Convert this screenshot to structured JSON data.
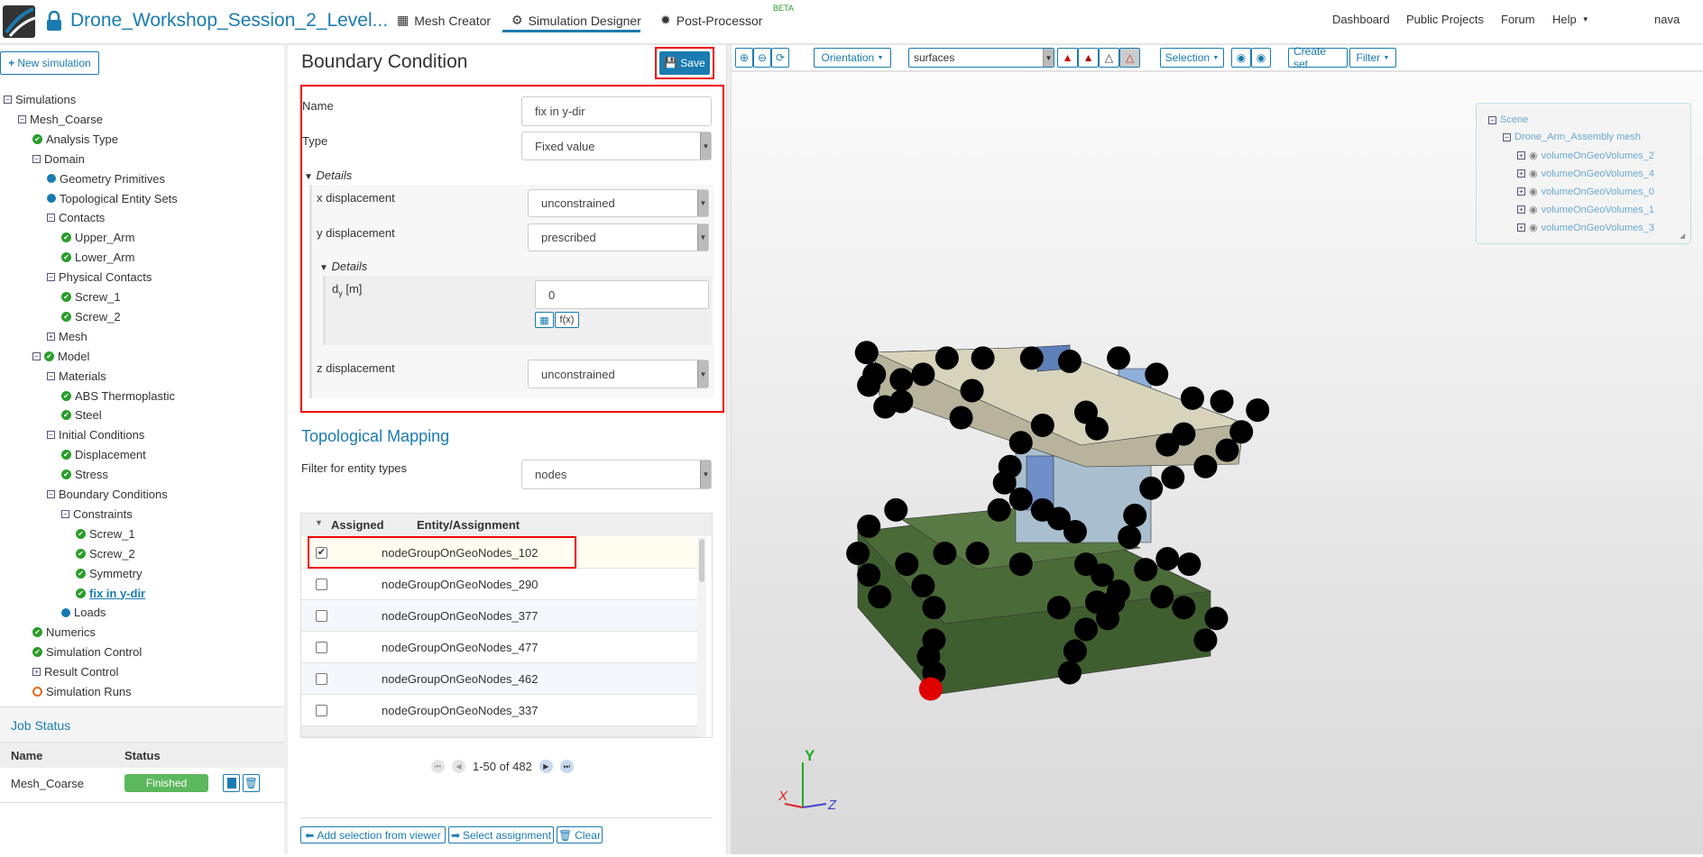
{
  "nav": {
    "project_title": "Drone_Workshop_Session_2_Level...",
    "tabs": [
      {
        "label": "Mesh Creator"
      },
      {
        "label": "Simulation Designer"
      },
      {
        "label": "Post-Processor"
      }
    ],
    "beta": "BETA",
    "right": [
      {
        "label": "Dashboard"
      },
      {
        "label": "Public Projects"
      },
      {
        "label": "Forum"
      },
      {
        "label": "Help"
      }
    ],
    "user": "nava"
  },
  "sidebar": {
    "new_simulation": "New simulation",
    "tree": [
      {
        "label": "Simulations",
        "level": 0,
        "icon": "minus"
      },
      {
        "label": "Mesh_Coarse",
        "level": 1,
        "icon": "minus"
      },
      {
        "label": "Analysis Type",
        "level": 2,
        "icon": "ok"
      },
      {
        "label": "Domain",
        "level": 2,
        "icon": "minus"
      },
      {
        "label": "Geometry Primitives",
        "level": 3,
        "icon": "dot"
      },
      {
        "label": "Topological Entity Sets",
        "level": 3,
        "icon": "dot"
      },
      {
        "label": "Contacts",
        "level": 3,
        "icon": "minus"
      },
      {
        "label": "Upper_Arm",
        "level": 4,
        "icon": "ok"
      },
      {
        "label": "Lower_Arm",
        "level": 4,
        "icon": "ok"
      },
      {
        "label": "Physical Contacts",
        "level": 3,
        "icon": "minus"
      },
      {
        "label": "Screw_1",
        "level": 4,
        "icon": "ok"
      },
      {
        "label": "Screw_2",
        "level": 4,
        "icon": "ok"
      },
      {
        "label": "Mesh",
        "level": 3,
        "icon": "plus"
      },
      {
        "label": "Model",
        "level": 2,
        "icon": "minus-ok"
      },
      {
        "label": "Materials",
        "level": 3,
        "icon": "minus"
      },
      {
        "label": "ABS Thermoplastic",
        "level": 4,
        "icon": "ok"
      },
      {
        "label": "Steel",
        "level": 4,
        "icon": "ok"
      },
      {
        "label": "Initial Conditions",
        "level": 3,
        "icon": "minus"
      },
      {
        "label": "Displacement",
        "level": 4,
        "icon": "ok"
      },
      {
        "label": "Stress",
        "level": 4,
        "icon": "ok"
      },
      {
        "label": "Boundary Conditions",
        "level": 3,
        "icon": "minus"
      },
      {
        "label": "Constraints",
        "level": 4,
        "icon": "minus"
      },
      {
        "label": "Screw_1",
        "level": 5,
        "icon": "ok"
      },
      {
        "label": "Screw_2",
        "level": 5,
        "icon": "ok"
      },
      {
        "label": "Symmetry",
        "level": 5,
        "icon": "ok"
      },
      {
        "label": "fix in y-dir",
        "level": 5,
        "icon": "ok",
        "active": true
      },
      {
        "label": "Loads",
        "level": 4,
        "icon": "dot"
      },
      {
        "label": "Numerics",
        "level": 2,
        "icon": "ok"
      },
      {
        "label": "Simulation Control",
        "level": 2,
        "icon": "ok"
      },
      {
        "label": "Result Control",
        "level": 2,
        "icon": "plus"
      },
      {
        "label": "Simulation Runs",
        "level": 2,
        "icon": "ring"
      }
    ]
  },
  "job_status": {
    "title": "Job Status",
    "col_name": "Name",
    "col_status": "Status",
    "rows": [
      {
        "name": "Mesh_Coarse",
        "status": "Finished"
      }
    ]
  },
  "form": {
    "title": "Boundary Condition",
    "save": "Save",
    "name_label": "Name",
    "name_value": "fix in y-dir",
    "type_label": "Type",
    "type_value": "Fixed value",
    "details": "Details",
    "x_label": "x displacement",
    "x_value": "unconstrained",
    "y_label": "y displacement",
    "y_value": "prescribed",
    "inner_details": "Details",
    "dy_label": "d",
    "dy_sub": "y",
    "dy_unit": " [m]",
    "dy_value": "0",
    "fx": "f(x)",
    "z_label": "z displacement",
    "z_value": "unconstrained"
  },
  "mapping": {
    "title": "Topological Mapping",
    "filter_label": "Filter for entity types",
    "filter_value": "nodes",
    "col_assigned": "Assigned",
    "col_entity": "Entity/Assignment",
    "rows": [
      {
        "name": "nodeGroupOnGeoNodes_102",
        "checked": true
      },
      {
        "name": "nodeGroupOnGeoNodes_290",
        "checked": false
      },
      {
        "name": "nodeGroupOnGeoNodes_377",
        "checked": false
      },
      {
        "name": "nodeGroupOnGeoNodes_477",
        "checked": false
      },
      {
        "name": "nodeGroupOnGeoNodes_462",
        "checked": false
      },
      {
        "name": "nodeGroupOnGeoNodes_337",
        "checked": false
      }
    ],
    "pagination": "1-50 of 482",
    "add_selection": "Add selection from viewer",
    "select_assignment": "Select assignment",
    "clear": "Clear"
  },
  "viewer": {
    "orientation": "Orientation",
    "render_mode": "surfaces",
    "selection": "Selection",
    "create_set": "Create set",
    "filter": "Filter",
    "scene": {
      "root": "Scene",
      "mesh": "Drone_Arm_Assembly mesh",
      "volumes": [
        "volumeOnGeoVolumes_2",
        "volumeOnGeoVolumes_4",
        "volumeOnGeoVolumes_0",
        "volumeOnGeoVolumes_1",
        "volumeOnGeoVolumes_3"
      ]
    },
    "axes": {
      "x": "X",
      "y": "Y",
      "z": "Z"
    },
    "colors": {
      "accent": "#1a7bb0",
      "selected_node": "#e00000",
      "plate_top": "#d8d4bc",
      "plate_bottom": "#4a6a38"
    }
  }
}
